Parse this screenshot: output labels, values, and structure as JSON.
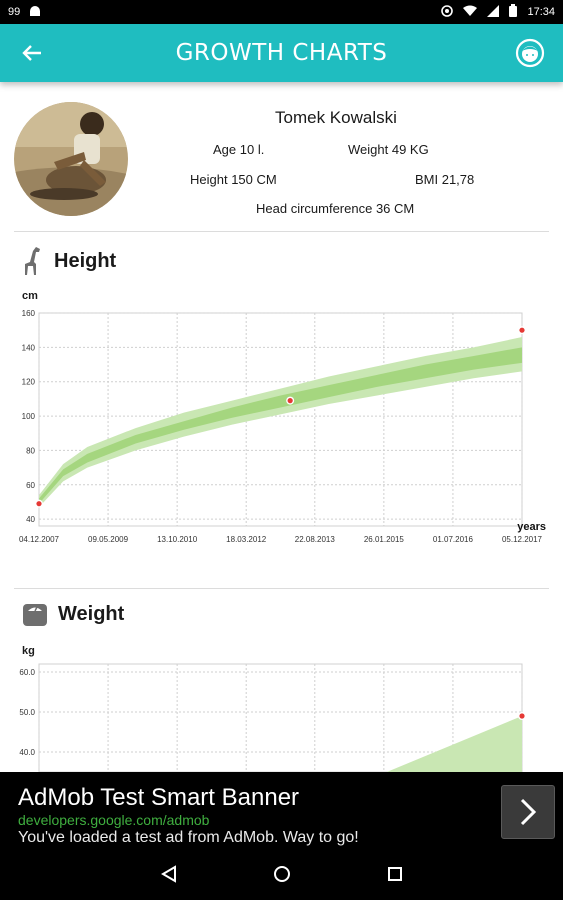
{
  "status_bar": {
    "left_text": "99",
    "time": "17:34"
  },
  "app_bar": {
    "title": "GROWTH CHARTS"
  },
  "profile": {
    "name": "Tomek Kowalski",
    "age": "Age 10 l.",
    "weight": "Weight 49 KG",
    "height": "Height 150 CM",
    "bmi": "BMI 21,78",
    "head": "Head circumference 36 CM"
  },
  "height_section": {
    "title": "Height",
    "unit": "cm",
    "icon": "giraffe-icon",
    "chart_data": {
      "type": "area",
      "title": "Height",
      "ylabel": "cm",
      "xlabel": "years",
      "ylim": [
        36,
        160
      ],
      "y_ticks": [
        40,
        60,
        80,
        100,
        120,
        140,
        160
      ],
      "x_ticks": [
        "04.12.2007",
        "09.05.2009",
        "13.10.2010",
        "18.03.2012",
        "22.08.2013",
        "26.01.2015",
        "01.07.2016",
        "05.12.2017"
      ],
      "x_years": [
        0,
        1.43,
        2.86,
        4.29,
        5.71,
        7.14,
        8.57,
        10
      ],
      "band_outer": {
        "x": [
          0,
          0.5,
          1,
          2,
          3,
          4,
          5,
          6,
          7,
          8,
          9,
          10
        ],
        "lower": [
          47,
          62,
          70,
          80,
          88,
          95,
          101,
          107,
          112,
          117,
          122,
          126
        ],
        "upper": [
          54,
          72,
          82,
          93,
          102,
          109,
          116,
          123,
          129,
          135,
          140,
          146
        ]
      },
      "band_inner": {
        "x": [
          0,
          0.5,
          1,
          2,
          3,
          4,
          5,
          6,
          7,
          8,
          9,
          10
        ],
        "lower": [
          49,
          65,
          73,
          84,
          92,
          99,
          105,
          111,
          117,
          122,
          127,
          131
        ],
        "upper": [
          52,
          69,
          78,
          89,
          97,
          105,
          112,
          118,
          124,
          130,
          135,
          140
        ]
      },
      "points": [
        {
          "x": 0,
          "y": 49
        },
        {
          "x": 5.2,
          "y": 109
        },
        {
          "x": 10,
          "y": 150
        }
      ],
      "colors": {
        "band_outer": "#c9e7b3",
        "band_inner": "#a5d67f",
        "point": "#e53935"
      }
    }
  },
  "weight_section": {
    "title": "Weight",
    "unit": "kg",
    "icon": "weight-icon",
    "chart_data": {
      "type": "area",
      "title": "Weight",
      "ylabel": "kg",
      "ylim": [
        35,
        62
      ],
      "y_ticks": [
        "40.0",
        "50.0",
        "60.0"
      ],
      "y_values": [
        40,
        50,
        60
      ],
      "band_outer": {
        "x": [
          7.2,
          10
        ],
        "lower": [
          35,
          35
        ],
        "upper": [
          35,
          49
        ]
      },
      "points": [
        {
          "x": 10,
          "y": 49
        }
      ],
      "colors": {
        "band_outer": "#c9e7b3",
        "point": "#e53935"
      }
    }
  },
  "ad": {
    "title": "AdMob Test Smart Banner",
    "url": "developers.google.com/admob",
    "description": "You've loaded a test ad from AdMob. Way to go!"
  }
}
